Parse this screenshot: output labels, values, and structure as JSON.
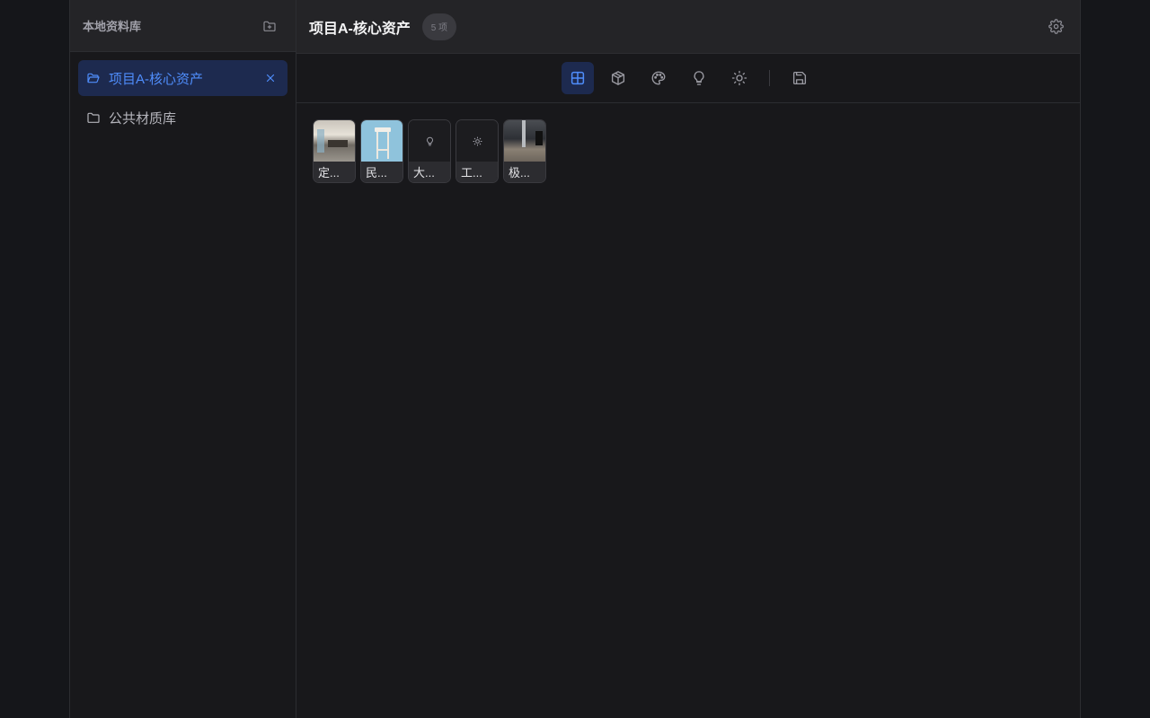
{
  "sidebar": {
    "title": "本地资料库",
    "items": [
      {
        "label": "项目A-核心资产",
        "active": true,
        "icon": "folder-open-icon"
      },
      {
        "label": "公共材质库",
        "active": false,
        "icon": "folder-icon"
      }
    ]
  },
  "header": {
    "title": "项目A-核心资产",
    "count": "5 项"
  },
  "toolbar": {
    "tools": [
      "grid-icon",
      "box-icon",
      "palette-icon",
      "lightbulb-icon",
      "sun-icon",
      "save-icon"
    ],
    "active": "grid-icon"
  },
  "assets": [
    {
      "label": "定...",
      "thumb": "room-photo"
    },
    {
      "label": "民...",
      "thumb": "stool-photo"
    },
    {
      "label": "大...",
      "thumb": "lightbulb-icon"
    },
    {
      "label": "工...",
      "thumb": "sun-icon"
    },
    {
      "label": "极...",
      "thumb": "hall-photo"
    }
  ],
  "colors": {
    "accent": "#4f8dfb",
    "active_bg": "#1d2a4f",
    "panel_bg": "#18181b",
    "header_bg": "#242427"
  }
}
